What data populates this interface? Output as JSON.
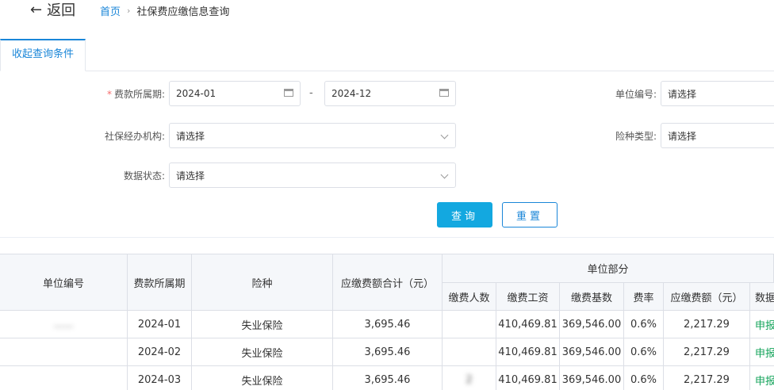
{
  "header": {
    "back_arrow": "←",
    "back_label": "返回",
    "breadcrumb_home": "首页",
    "breadcrumb_sep": "›",
    "breadcrumb_current": "社保费应缴信息查询"
  },
  "tab": {
    "label": "收起查询条件"
  },
  "form": {
    "period_label": "费款所属期:",
    "period_required": "*",
    "period_start": "2024-01",
    "period_sep": "-",
    "period_end": "2024-12",
    "unit_code_label": "单位编号:",
    "unit_code_placeholder": "请选择",
    "agency_label": "社保经办机构:",
    "agency_placeholder": "请选择",
    "insurance_label": "险种类型:",
    "insurance_placeholder": "请选择",
    "status_label": "数据状态:",
    "status_placeholder": "请选择",
    "query_button": "查询",
    "reset_button": "重置"
  },
  "table": {
    "headers": {
      "unit_code": "单位编号",
      "period": "费款所属期",
      "insurance": "险种",
      "total": "应缴费额合计（元）",
      "unit_part": "单位部分",
      "payers": "缴费人数",
      "wage": "缴费工资",
      "base": "缴费基数",
      "rate": "费率",
      "amount": "应缴费额（元）",
      "status": "数据"
    },
    "rows": [
      {
        "unit_code": "......",
        "period": "2024-01",
        "insurance": "失业保险",
        "total": "3,695.46",
        "payers": "",
        "wage": "410,469.81",
        "base": "369,546.00",
        "rate": "0.6%",
        "amount": "2,217.29",
        "status": "申报"
      },
      {
        "unit_code": "",
        "period": "2024-02",
        "insurance": "失业保险",
        "total": "3,695.46",
        "payers": "",
        "wage": "410,469.81",
        "base": "369,546.00",
        "rate": "0.6%",
        "amount": "2,217.29",
        "status": "申报"
      },
      {
        "unit_code": "",
        "period": "2024-03",
        "insurance": "失业保险",
        "total": "3,695.46",
        "payers": "2",
        "wage": "410,469.81",
        "base": "369,546.00",
        "rate": "0.6%",
        "amount": "2,217.29",
        "status": "申报"
      }
    ]
  },
  "colors": {
    "primary": "#13a8e0",
    "link": "#1a86d8",
    "success": "#13a35a",
    "required": "#f56c6c"
  }
}
